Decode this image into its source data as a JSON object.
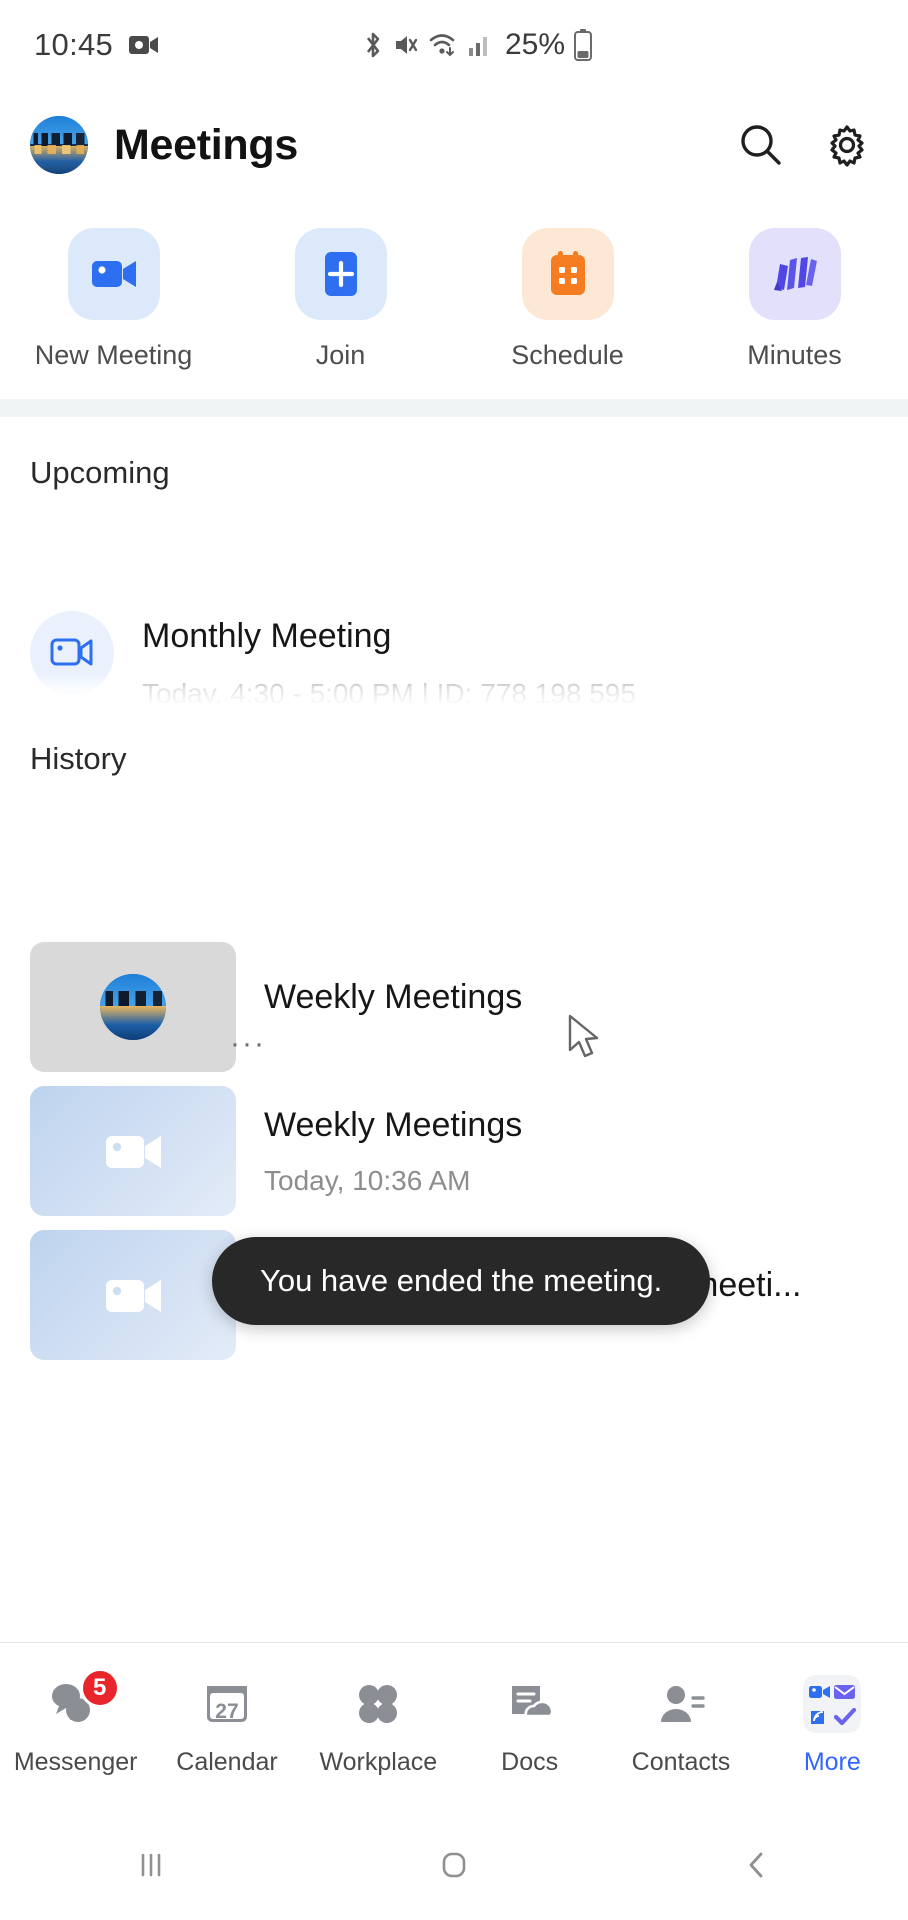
{
  "status_bar": {
    "time": "10:45",
    "battery_percent": "25%",
    "icons": [
      "video-record-icon",
      "bluetooth-icon",
      "mute-icon",
      "wifi-icon",
      "cellular-signal-icon",
      "battery-icon"
    ]
  },
  "header": {
    "title": "Meetings",
    "avatar_name": "user-avatar",
    "search_icon": "search-icon",
    "settings_icon": "gear-icon"
  },
  "actions": [
    {
      "label": "New Meeting",
      "icon": "video-camera-icon",
      "color": "#2e6ef0",
      "tile_bg": "#dce9fb"
    },
    {
      "label": "Join",
      "icon": "plus-icon",
      "color": "#2e6ef0",
      "tile_bg": "#dce9fb"
    },
    {
      "label": "Schedule",
      "icon": "calendar-icon",
      "color": "#f57c20",
      "tile_bg": "#fce8d5"
    },
    {
      "label": "Minutes",
      "icon": "minutes-icon",
      "color": "#4f46e5",
      "tile_bg": "#e2e0fb"
    }
  ],
  "sections": {
    "upcoming_title": "Upcoming",
    "history_title": "History"
  },
  "upcoming": [
    {
      "title": "Monthly Meeting",
      "subtitle": "Today, 4:30 - 5:00 PM  |  ID: 778 198 595",
      "icon": "video-camera-icon"
    }
  ],
  "history": [
    {
      "title": "Weekly Meetings",
      "time": "",
      "thumb": "gray-thumbnail-with-avatar",
      "more": "···"
    },
    {
      "title": "Weekly Meetings",
      "time": "Today, 10:36 AM",
      "thumb": "blue-video-thumbnail"
    },
    {
      "title": "Ethan Smith (Snow)'s video meeti...",
      "time": "",
      "thumb": "blue-video-thumbnail"
    }
  ],
  "toast": {
    "message": "You have ended the meeting."
  },
  "bottom_nav": {
    "items": [
      {
        "label": "Messenger",
        "icon": "messenger-icon",
        "badge": "5",
        "active": false
      },
      {
        "label": "Calendar",
        "icon": "calendar-icon",
        "day": "27",
        "active": false
      },
      {
        "label": "Workplace",
        "icon": "workplace-grid-icon",
        "active": false
      },
      {
        "label": "Docs",
        "icon": "docs-cloud-icon",
        "active": false
      },
      {
        "label": "Contacts",
        "icon": "contacts-icon",
        "active": false
      },
      {
        "label": "More",
        "icon": "more-apps-icon",
        "active": true
      }
    ],
    "active_color": "#3366ff"
  },
  "system_nav": {
    "recents": "recents-icon",
    "home": "home-icon",
    "back": "back-icon"
  },
  "colors": {
    "accent_blue": "#2e6ef0",
    "accent_orange": "#f57c20",
    "accent_purple": "#4f46e5",
    "badge_red": "#e8252a",
    "toast_bg": "#282828",
    "band": "#f0f4f4"
  }
}
